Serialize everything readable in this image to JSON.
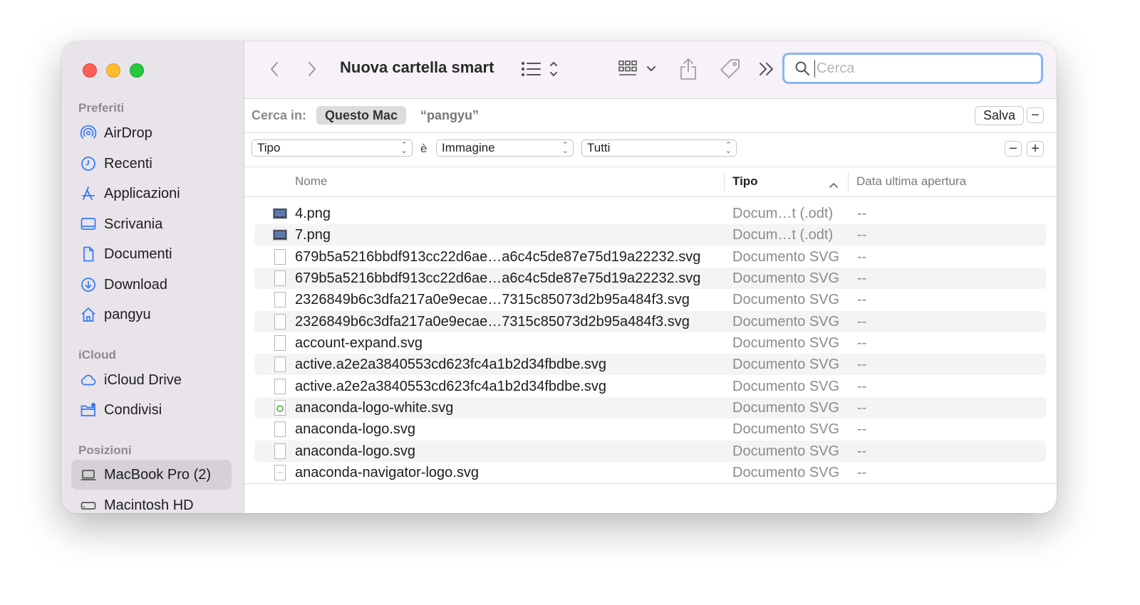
{
  "window": {
    "title": "Nuova cartella smart"
  },
  "sidebar": {
    "sections": [
      {
        "label": "Preferiti",
        "items": [
          {
            "label": "AirDrop",
            "icon": "airdrop-icon"
          },
          {
            "label": "Recenti",
            "icon": "clock-icon"
          },
          {
            "label": "Applicazioni",
            "icon": "applications-icon"
          },
          {
            "label": "Scrivania",
            "icon": "desktop-icon"
          },
          {
            "label": "Documenti",
            "icon": "document-icon"
          },
          {
            "label": "Download",
            "icon": "download-icon"
          },
          {
            "label": "pangyu",
            "icon": "home-icon"
          }
        ]
      },
      {
        "label": "iCloud",
        "items": [
          {
            "label": "iCloud Drive",
            "icon": "cloud-icon"
          },
          {
            "label": "Condivisi",
            "icon": "shared-folder-icon"
          }
        ]
      },
      {
        "label": "Posizioni",
        "items": [
          {
            "label": "MacBook Pro (2)",
            "icon": "laptop-icon",
            "selected": true
          },
          {
            "label": "Macintosh HD",
            "icon": "disk-icon"
          }
        ]
      }
    ]
  },
  "toolbar": {
    "search_placeholder": "Cerca"
  },
  "scope": {
    "label": "Cerca in:",
    "selected": "Questo Mac",
    "query": "“pangyu”",
    "save_label": "Salva",
    "remove_label": "−"
  },
  "criteria": {
    "attribute": "Tipo",
    "operator": "è",
    "value": "Immagine",
    "sub_value": "Tutti",
    "remove_label": "−",
    "add_label": "+"
  },
  "columns": {
    "name": "Nome",
    "kind": "Tipo",
    "date": "Data ultima apertura"
  },
  "files": [
    {
      "name": "4.png",
      "kind": "Docum…t (.odt)",
      "date": "--",
      "icon": "image-file-icon"
    },
    {
      "name": "7.png",
      "kind": "Docum…t (.odt)",
      "date": "--",
      "icon": "image-file-icon"
    },
    {
      "name": "679b5a5216bbdf913cc22d6ae…a6c4c5de87e75d19a22232.svg",
      "kind": "Documento SVG",
      "date": "--",
      "icon": "svg-file-icon"
    },
    {
      "name": "679b5a5216bbdf913cc22d6ae…a6c4c5de87e75d19a22232.svg",
      "kind": "Documento SVG",
      "date": "--",
      "icon": "svg-file-icon"
    },
    {
      "name": "2326849b6c3dfa217a0e9ecae…7315c85073d2b95a484f3.svg",
      "kind": "Documento SVG",
      "date": "--",
      "icon": "svg-file-icon"
    },
    {
      "name": "2326849b6c3dfa217a0e9ecae…7315c85073d2b95a484f3.svg",
      "kind": "Documento SVG",
      "date": "--",
      "icon": "svg-file-icon"
    },
    {
      "name": "account-expand.svg",
      "kind": "Documento SVG",
      "date": "--",
      "icon": "svg-file-icon"
    },
    {
      "name": "active.a2e2a3840553cd623fc4a1b2d34fbdbe.svg",
      "kind": "Documento SVG",
      "date": "--",
      "icon": "svg-file-icon"
    },
    {
      "name": "active.a2e2a3840553cd623fc4a1b2d34fbdbe.svg",
      "kind": "Documento SVG",
      "date": "--",
      "icon": "svg-file-icon"
    },
    {
      "name": "anaconda-logo-white.svg",
      "kind": "Documento SVG",
      "date": "--",
      "icon": "anaconda-file-icon"
    },
    {
      "name": "anaconda-logo.svg",
      "kind": "Documento SVG",
      "date": "--",
      "icon": "svg-file-icon"
    },
    {
      "name": "anaconda-logo.svg",
      "kind": "Documento SVG",
      "date": "--",
      "icon": "svg-file-icon"
    },
    {
      "name": "anaconda-navigator-logo.svg",
      "kind": "Documento SVG",
      "date": "--",
      "icon": "svg-file-icon"
    }
  ],
  "colors": {
    "sidebar_icon": "#3478f6",
    "search_focus": "#8ab4f2",
    "selection": "#d6d1d7"
  }
}
